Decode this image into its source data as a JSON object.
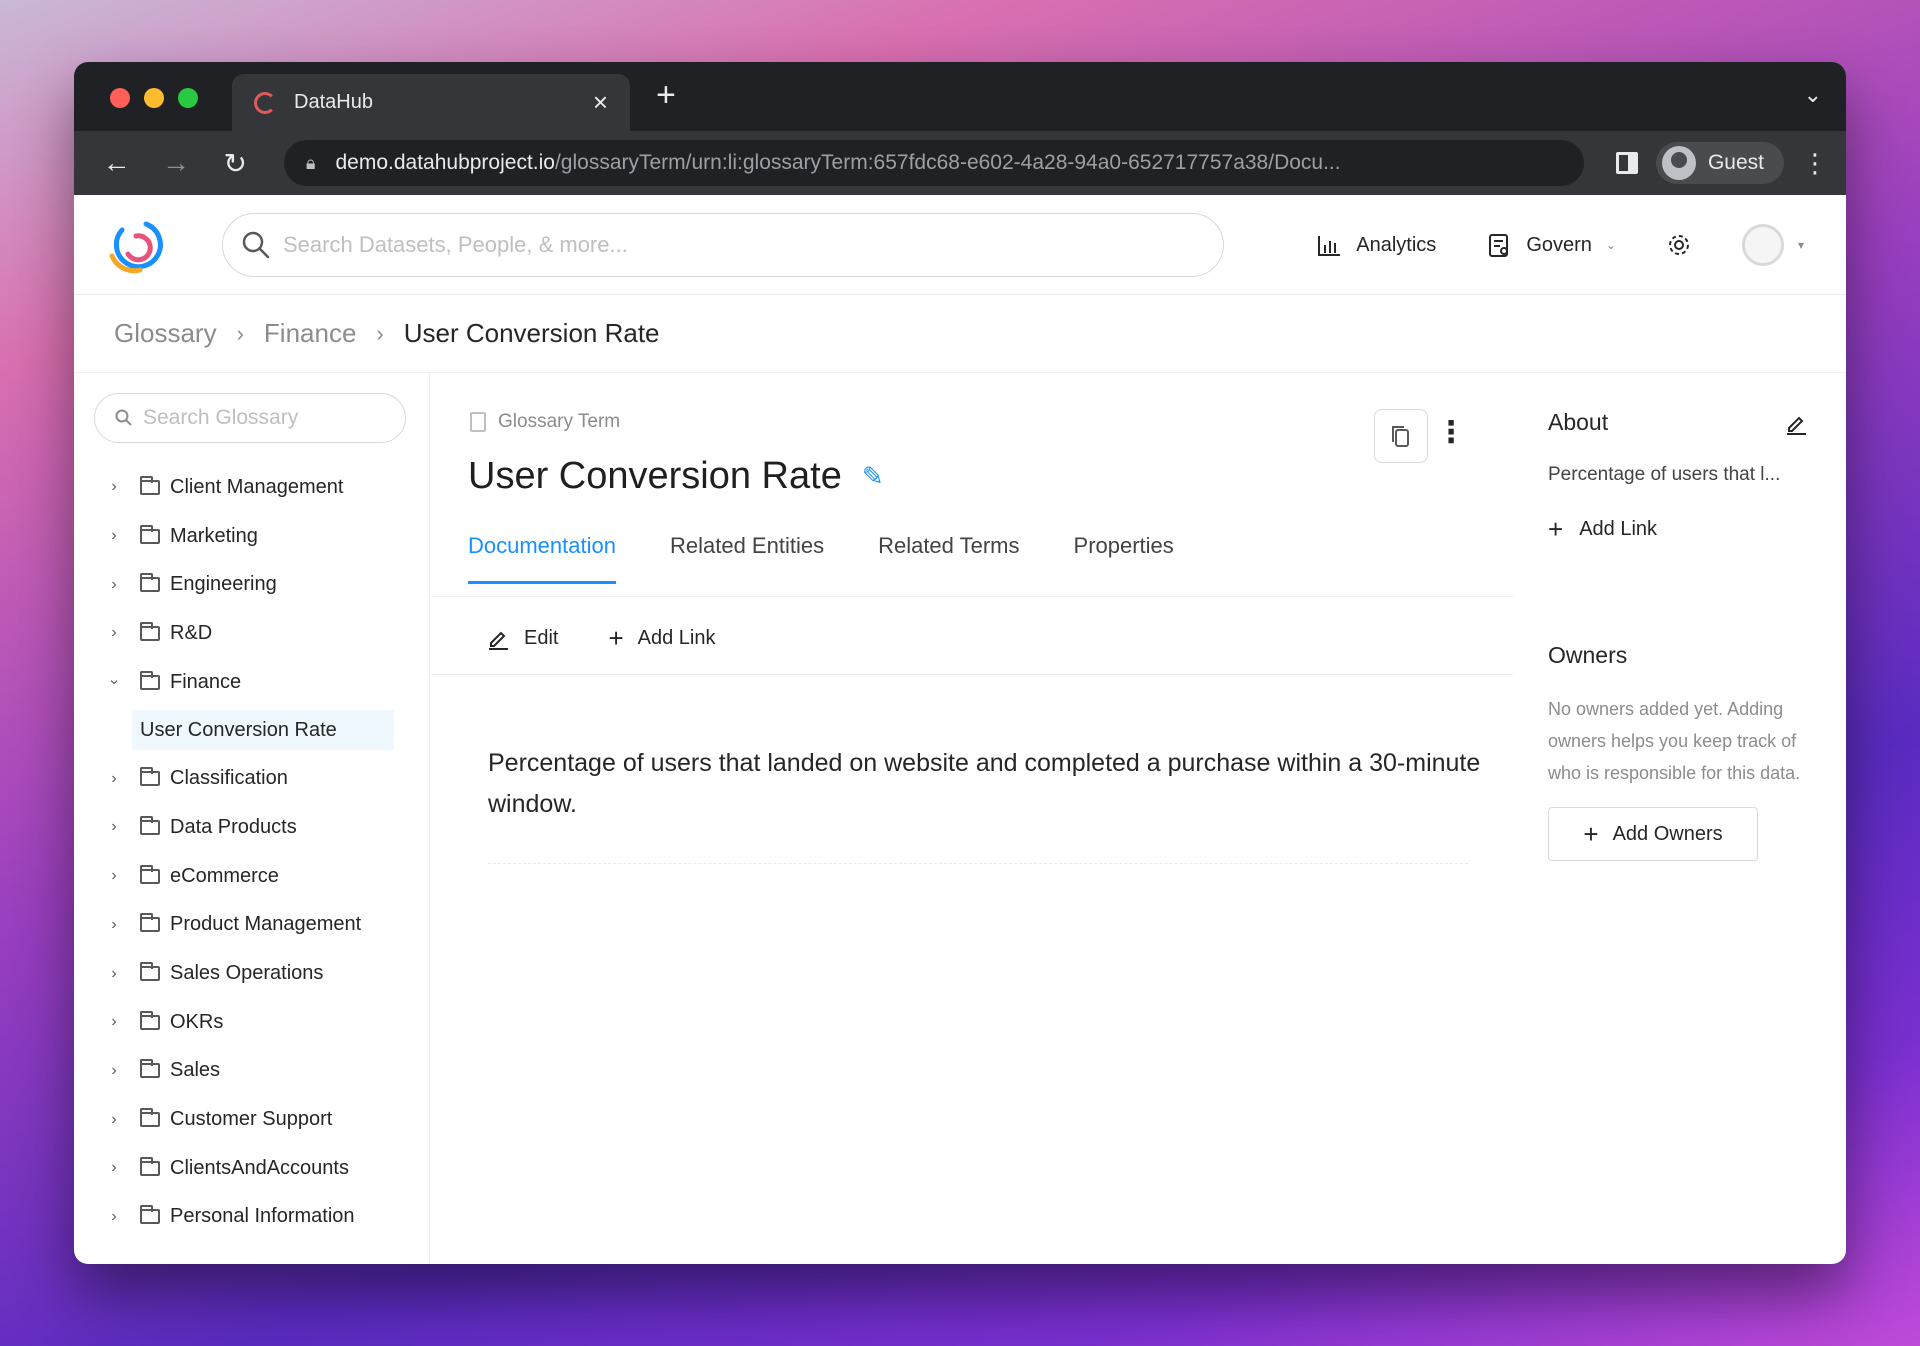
{
  "browser": {
    "tab_title": "DataHub",
    "url_host": "demo.datahubproject.io",
    "url_path": "/glossaryTerm/urn:li:glossaryTerm:657fdc68-e602-4a28-94a0-652717757a38/Docu...",
    "profile_name": "Guest"
  },
  "header": {
    "search_placeholder": "Search Datasets, People, & more...",
    "analytics_label": "Analytics",
    "govern_label": "Govern"
  },
  "breadcrumb": {
    "items": [
      "Glossary",
      "Finance"
    ],
    "current": "User Conversion Rate"
  },
  "sidebar": {
    "search_placeholder": "Search Glossary",
    "items": [
      {
        "label": "Client Management"
      },
      {
        "label": "Marketing"
      },
      {
        "label": "Engineering"
      },
      {
        "label": "R&D"
      },
      {
        "label": "Finance",
        "expanded": true,
        "children": [
          "User Conversion Rate"
        ]
      },
      {
        "label": "Classification"
      },
      {
        "label": "Data Products"
      },
      {
        "label": "eCommerce"
      },
      {
        "label": "Product Management"
      },
      {
        "label": "Sales Operations"
      },
      {
        "label": "OKRs"
      },
      {
        "label": "Sales"
      },
      {
        "label": "Customer Support"
      },
      {
        "label": "ClientsAndAccounts"
      },
      {
        "label": "Personal Information"
      }
    ]
  },
  "entity": {
    "type_label": "Glossary Term",
    "title": "User Conversion Rate",
    "tabs": [
      "Documentation",
      "Related Entities",
      "Related Terms",
      "Properties"
    ],
    "active_tab": "Documentation",
    "actions": {
      "edit": "Edit",
      "add_link": "Add Link"
    },
    "documentation": "Percentage of users that landed on website and completed a purchase within a 30-minute window."
  },
  "about": {
    "heading": "About",
    "summary": "Percentage of users that l...",
    "add_link": "Add Link"
  },
  "owners": {
    "heading": "Owners",
    "empty_text": "No owners added yet. Adding owners helps you keep track of who is responsible for this data.",
    "add_button": "Add Owners"
  },
  "colors": {
    "accent": "#1890ff",
    "selected_bg": "#f0f8ff"
  }
}
